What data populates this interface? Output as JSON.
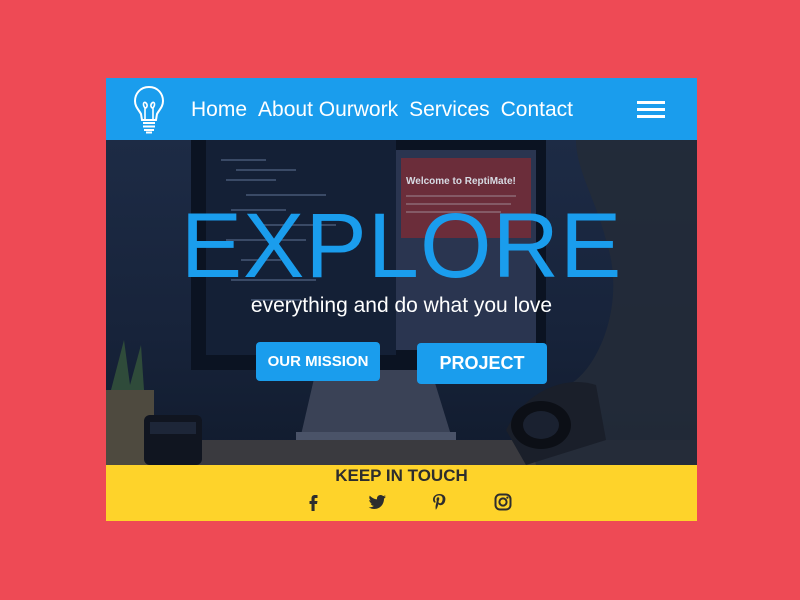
{
  "nav": {
    "items": [
      {
        "label": "Home"
      },
      {
        "label": "About Ourwork"
      },
      {
        "label": "Services"
      },
      {
        "label": "Contact"
      }
    ]
  },
  "hero": {
    "title": "EXPLORE",
    "subtitle": "everything and do what you love",
    "buttons": {
      "mission": "OUR MISSION",
      "project": "PROJECT"
    },
    "screen_text": "Welcome to ReptiMate!"
  },
  "footer": {
    "title": "KEEP IN TOUCH",
    "social": [
      "facebook-icon",
      "twitter-icon",
      "pinterest-icon",
      "instagram-icon"
    ]
  },
  "colors": {
    "page_background": "#ee4a55",
    "accent_blue": "#1a9ded",
    "footer_yellow": "#fed32a",
    "hero_dark": "#17233a"
  }
}
